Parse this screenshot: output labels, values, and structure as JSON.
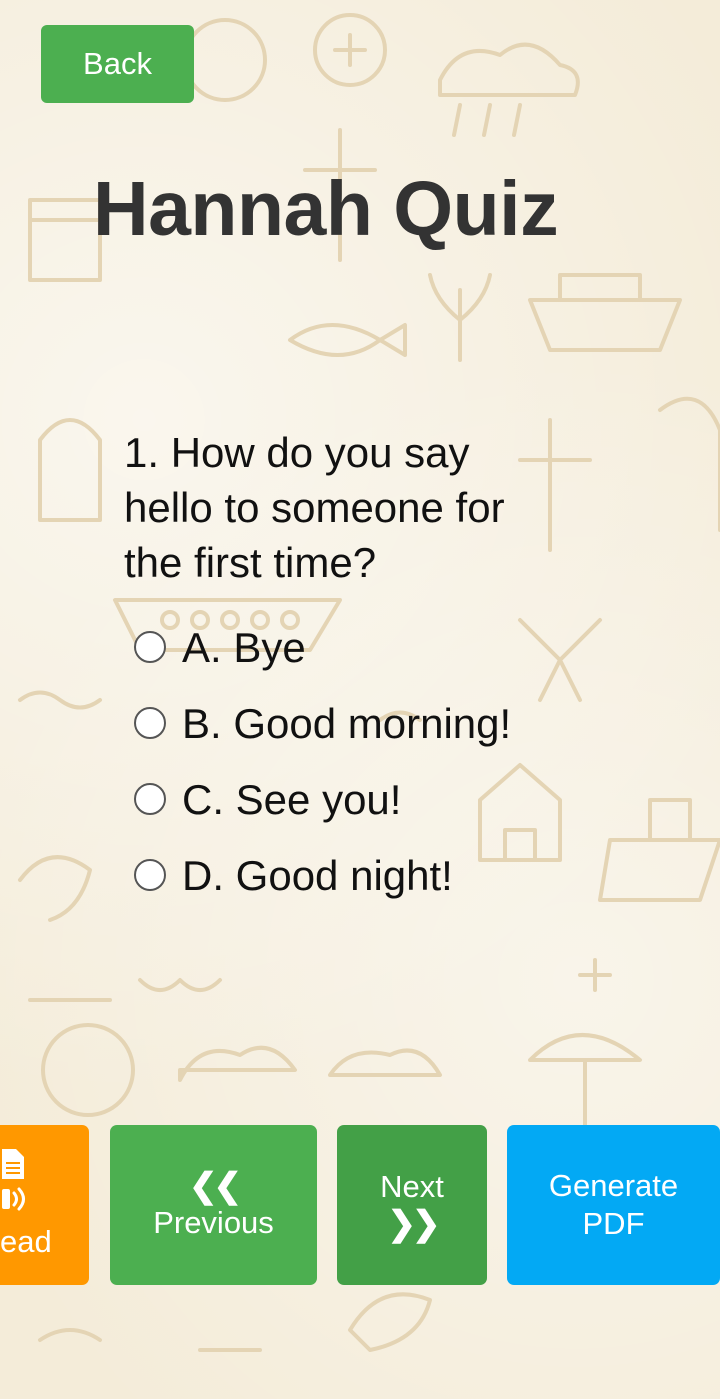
{
  "header": {
    "back_label": "Back",
    "title": "Hannah Quiz"
  },
  "quiz": {
    "question": "1. How do you say hello to someone for the first time?",
    "options": [
      {
        "label": "A. Bye"
      },
      {
        "label": "B. Good morning!"
      },
      {
        "label": "C. See you!"
      },
      {
        "label": "D. Good night!"
      }
    ]
  },
  "footer": {
    "read_label": "ead",
    "read_icon": "document-audio-icon",
    "previous_chevron": "❮❮",
    "previous_label": "Previous",
    "next_label": "Next",
    "next_chevron": "❯❯",
    "pdf_label": "Generate PDF"
  },
  "colors": {
    "back": "#4caf50",
    "read": "#ff9800",
    "previous": "#4caf50",
    "next": "#43a047",
    "pdf": "#03a9f4",
    "title": "#333333",
    "background": "#f4ecd9"
  }
}
